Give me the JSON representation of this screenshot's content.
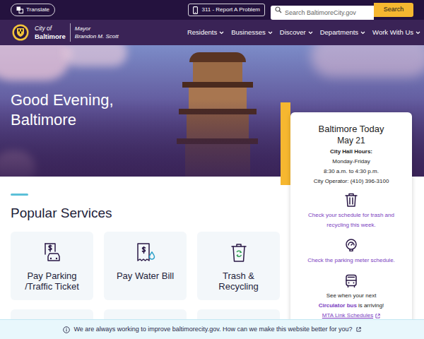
{
  "topbar": {
    "translate": "Translate",
    "report": "311 - Report A Problem",
    "search": {
      "placeholder": "Search BaltimoreCity.gov",
      "button": "Search"
    }
  },
  "brand": {
    "city_of": "City of",
    "city": "Baltimore",
    "mayor_title": "Mayor",
    "mayor_name": "Brandon M. Scott"
  },
  "nav": [
    {
      "label": "Residents"
    },
    {
      "label": "Businesses"
    },
    {
      "label": "Discover"
    },
    {
      "label": "Departments"
    },
    {
      "label": "Work With Us"
    }
  ],
  "hero": {
    "greeting": "Good Evening,",
    "city": "Baltimore"
  },
  "today": {
    "title": "Baltimore Today",
    "date": "May 21",
    "hours_label": "City Hall Hours:",
    "days": "Monday-Friday",
    "hours": "8:30 a.m. to 4:30 p.m.",
    "operator": "City Operator: (410) 396-3100",
    "trash_link": "Check your schedule for trash and recycling this week.",
    "parking_link": "Check the parking meter schedule.",
    "bus_intro": "See when your next",
    "bus_link": "Circulator bus",
    "bus_outro": "is arriving!",
    "mta_link": "MTA Link Schedules"
  },
  "services": {
    "title": "Popular Services",
    "items": [
      {
        "label": "Pay Parking /Traffic Ticket"
      },
      {
        "label": "Pay Water Bill"
      },
      {
        "label": "Trash & Recycling"
      }
    ]
  },
  "feedback": {
    "text": "We are always working to improve baltimorecity.gov. How can we make this website better for you?"
  }
}
